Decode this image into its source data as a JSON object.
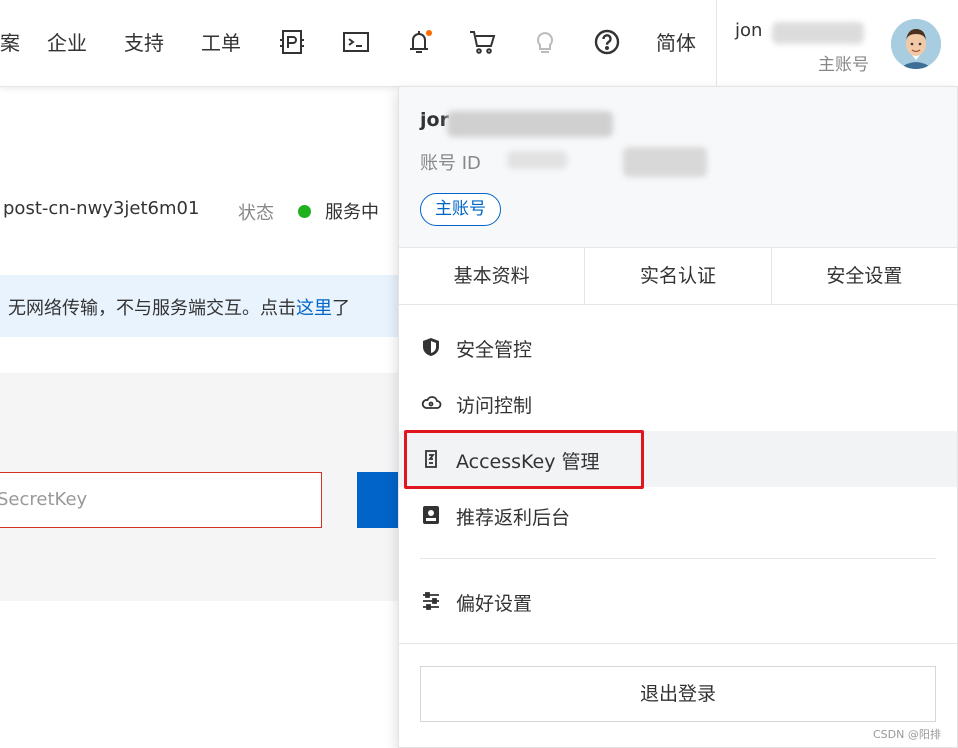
{
  "nav": {
    "items": [
      "案",
      "企业",
      "支持",
      "工单"
    ],
    "icons": [
      "icp-icon",
      "terminal-icon",
      "bell-icon",
      "cart-icon",
      "lightbulb-icon",
      "help-icon"
    ],
    "language": "简体",
    "notification_dot_color": "#ff6a00"
  },
  "user": {
    "name_partial": "jon",
    "role": "主账号"
  },
  "page": {
    "instance_id": "post-cn-nwy3jet6m01",
    "status_label": "状态",
    "status_value": "服务中",
    "status_color": "#1fb11f",
    "notice_text": "无网络传输，不与服务端交互。点击",
    "notice_link": "这里",
    "notice_tail": "了",
    "secret_placeholder": "SecretKey"
  },
  "dropdown": {
    "name_partial": "jor",
    "account_id_label": "账号 ID",
    "role_tag": "主账号",
    "tabs": [
      "基本资料",
      "实名认证",
      "安全设置"
    ],
    "menu": [
      {
        "label": "安全管控",
        "icon": "shield-icon"
      },
      {
        "label": "访问控制",
        "icon": "cloud-icon"
      },
      {
        "label": "AccessKey 管理",
        "icon": "accesskey-icon"
      },
      {
        "label": "推荐返利后台",
        "icon": "rebate-icon"
      },
      {
        "label": "偏好设置",
        "icon": "sliders-icon"
      }
    ],
    "logout": "退出登录"
  },
  "watermark": "CSDN @阳排",
  "colors": {
    "brand_blue": "#0064c8",
    "highlight_red": "#e0161e"
  }
}
